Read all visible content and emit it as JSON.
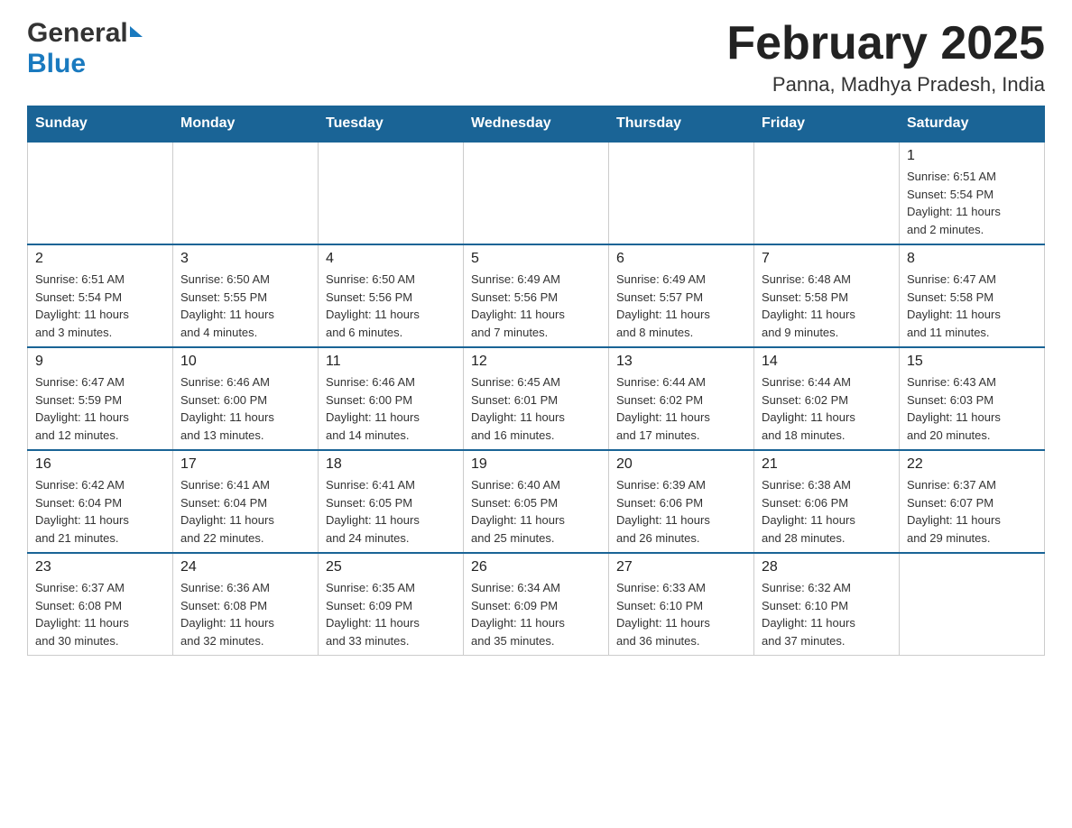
{
  "header": {
    "logo_general": "General",
    "logo_blue": "Blue",
    "month_title": "February 2025",
    "location": "Panna, Madhya Pradesh, India"
  },
  "days_of_week": [
    "Sunday",
    "Monday",
    "Tuesday",
    "Wednesday",
    "Thursday",
    "Friday",
    "Saturday"
  ],
  "weeks": [
    [
      {
        "day": "",
        "info": ""
      },
      {
        "day": "",
        "info": ""
      },
      {
        "day": "",
        "info": ""
      },
      {
        "day": "",
        "info": ""
      },
      {
        "day": "",
        "info": ""
      },
      {
        "day": "",
        "info": ""
      },
      {
        "day": "1",
        "info": "Sunrise: 6:51 AM\nSunset: 5:54 PM\nDaylight: 11 hours\nand 2 minutes."
      }
    ],
    [
      {
        "day": "2",
        "info": "Sunrise: 6:51 AM\nSunset: 5:54 PM\nDaylight: 11 hours\nand 3 minutes."
      },
      {
        "day": "3",
        "info": "Sunrise: 6:50 AM\nSunset: 5:55 PM\nDaylight: 11 hours\nand 4 minutes."
      },
      {
        "day": "4",
        "info": "Sunrise: 6:50 AM\nSunset: 5:56 PM\nDaylight: 11 hours\nand 6 minutes."
      },
      {
        "day": "5",
        "info": "Sunrise: 6:49 AM\nSunset: 5:56 PM\nDaylight: 11 hours\nand 7 minutes."
      },
      {
        "day": "6",
        "info": "Sunrise: 6:49 AM\nSunset: 5:57 PM\nDaylight: 11 hours\nand 8 minutes."
      },
      {
        "day": "7",
        "info": "Sunrise: 6:48 AM\nSunset: 5:58 PM\nDaylight: 11 hours\nand 9 minutes."
      },
      {
        "day": "8",
        "info": "Sunrise: 6:47 AM\nSunset: 5:58 PM\nDaylight: 11 hours\nand 11 minutes."
      }
    ],
    [
      {
        "day": "9",
        "info": "Sunrise: 6:47 AM\nSunset: 5:59 PM\nDaylight: 11 hours\nand 12 minutes."
      },
      {
        "day": "10",
        "info": "Sunrise: 6:46 AM\nSunset: 6:00 PM\nDaylight: 11 hours\nand 13 minutes."
      },
      {
        "day": "11",
        "info": "Sunrise: 6:46 AM\nSunset: 6:00 PM\nDaylight: 11 hours\nand 14 minutes."
      },
      {
        "day": "12",
        "info": "Sunrise: 6:45 AM\nSunset: 6:01 PM\nDaylight: 11 hours\nand 16 minutes."
      },
      {
        "day": "13",
        "info": "Sunrise: 6:44 AM\nSunset: 6:02 PM\nDaylight: 11 hours\nand 17 minutes."
      },
      {
        "day": "14",
        "info": "Sunrise: 6:44 AM\nSunset: 6:02 PM\nDaylight: 11 hours\nand 18 minutes."
      },
      {
        "day": "15",
        "info": "Sunrise: 6:43 AM\nSunset: 6:03 PM\nDaylight: 11 hours\nand 20 minutes."
      }
    ],
    [
      {
        "day": "16",
        "info": "Sunrise: 6:42 AM\nSunset: 6:04 PM\nDaylight: 11 hours\nand 21 minutes."
      },
      {
        "day": "17",
        "info": "Sunrise: 6:41 AM\nSunset: 6:04 PM\nDaylight: 11 hours\nand 22 minutes."
      },
      {
        "day": "18",
        "info": "Sunrise: 6:41 AM\nSunset: 6:05 PM\nDaylight: 11 hours\nand 24 minutes."
      },
      {
        "day": "19",
        "info": "Sunrise: 6:40 AM\nSunset: 6:05 PM\nDaylight: 11 hours\nand 25 minutes."
      },
      {
        "day": "20",
        "info": "Sunrise: 6:39 AM\nSunset: 6:06 PM\nDaylight: 11 hours\nand 26 minutes."
      },
      {
        "day": "21",
        "info": "Sunrise: 6:38 AM\nSunset: 6:06 PM\nDaylight: 11 hours\nand 28 minutes."
      },
      {
        "day": "22",
        "info": "Sunrise: 6:37 AM\nSunset: 6:07 PM\nDaylight: 11 hours\nand 29 minutes."
      }
    ],
    [
      {
        "day": "23",
        "info": "Sunrise: 6:37 AM\nSunset: 6:08 PM\nDaylight: 11 hours\nand 30 minutes."
      },
      {
        "day": "24",
        "info": "Sunrise: 6:36 AM\nSunset: 6:08 PM\nDaylight: 11 hours\nand 32 minutes."
      },
      {
        "day": "25",
        "info": "Sunrise: 6:35 AM\nSunset: 6:09 PM\nDaylight: 11 hours\nand 33 minutes."
      },
      {
        "day": "26",
        "info": "Sunrise: 6:34 AM\nSunset: 6:09 PM\nDaylight: 11 hours\nand 35 minutes."
      },
      {
        "day": "27",
        "info": "Sunrise: 6:33 AM\nSunset: 6:10 PM\nDaylight: 11 hours\nand 36 minutes."
      },
      {
        "day": "28",
        "info": "Sunrise: 6:32 AM\nSunset: 6:10 PM\nDaylight: 11 hours\nand 37 minutes."
      },
      {
        "day": "",
        "info": ""
      }
    ]
  ]
}
